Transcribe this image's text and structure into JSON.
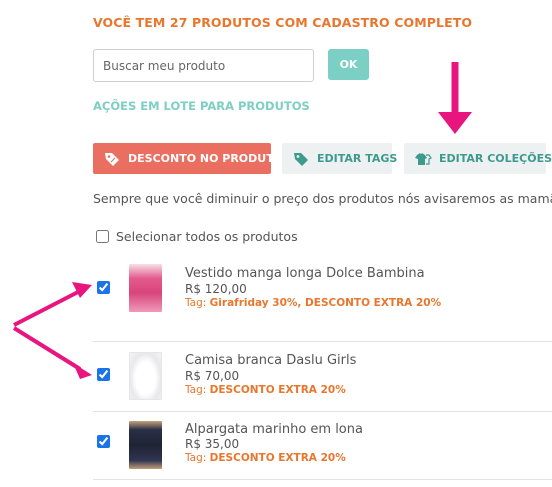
{
  "headline": "VOCÊ TEM 27 PRODUTOS COM CADASTRO COMPLETO",
  "search": {
    "placeholder": "Buscar meu produto",
    "value": "",
    "ok_label": "OK"
  },
  "bulk_actions": {
    "title": "AÇÕES EM LOTE PARA PRODUTOS",
    "discount_label": "DESCONTO NO PRODUTO",
    "tags_label": "EDITAR TAGS",
    "collections_label": "EDITAR COLEÇÕES"
  },
  "info_text": "Sempre que você diminuir o preço dos produtos nós avisaremos as mamã",
  "select_all_label": "Selecionar todos os produtos",
  "products": [
    {
      "name": "Vestido manga longa Dolce Bambina",
      "price": "R$ 120,00",
      "tag_label": "Tag:",
      "tags": "Girafriday 30%, DESCONTO EXTRA 20%",
      "checked": true
    },
    {
      "name": "Camisa branca Daslu Girls",
      "price": "R$ 70,00",
      "tag_label": "Tag:",
      "tags": "DESCONTO EXTRA 20%",
      "checked": true
    },
    {
      "name": "Alpargata marinho em lona",
      "price": "R$ 35,00",
      "tag_label": "Tag:",
      "tags": "DESCONTO EXTRA 20%",
      "checked": true
    }
  ],
  "colors": {
    "accent_orange": "#e8762d",
    "accent_teal": "#7ccfc4",
    "discount_button": "#ea6f61",
    "annotation_arrow": "#e8157f"
  },
  "icons": {
    "discount": "tag-percent-icon",
    "tags": "tag-icon",
    "collections": "clothes-icon"
  }
}
